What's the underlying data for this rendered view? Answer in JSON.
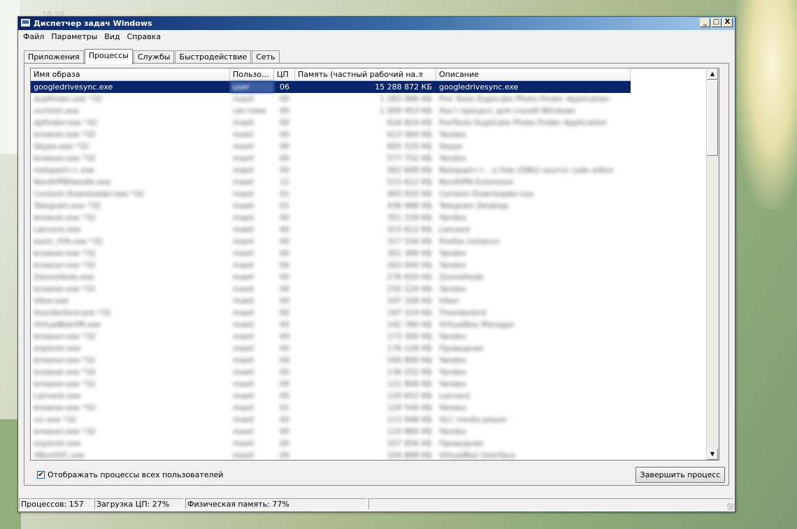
{
  "window": {
    "title": "Диспетчер задач Windows",
    "min": "_",
    "max": "□",
    "close": "X"
  },
  "menu": [
    "Файл",
    "Параметры",
    "Вид",
    "Справка"
  ],
  "tabs": [
    {
      "label": "Приложения",
      "active": false
    },
    {
      "label": "Процессы",
      "active": true
    },
    {
      "label": "Службы",
      "active": false
    },
    {
      "label": "Быстродействие",
      "active": false
    },
    {
      "label": "Сеть",
      "active": false
    }
  ],
  "columns": {
    "name": "Имя образа",
    "user": "Пользо...",
    "cpu": "ЦП",
    "memory": "Память (частный рабочий на...",
    "description": "Описание"
  },
  "processes": [
    {
      "name": "googledrivesync.exe",
      "user": "user",
      "cpu": "06",
      "memory": "15 288 872 КБ",
      "description": "googledrivesync.exe",
      "selected": true
    },
    {
      "name": "dupfinder.exe *32",
      "user": "maeli",
      "cpu": "00",
      "memory": "1 283 996 КБ",
      "description": "Fire Tools Duplicate Photo Finder Application"
    },
    {
      "name": "svchost.exe",
      "user": "система",
      "cpu": "00",
      "memory": "1 000 453 КБ",
      "description": "Хост-процесс для служб Windows"
    },
    {
      "name": "dpfinder.exe *32",
      "user": "maeli",
      "cpu": "00",
      "memory": "616 824 КБ",
      "description": "FireTools Duplicate Photo Finder Application"
    },
    {
      "name": "browser.exe *32",
      "user": "maeli",
      "cpu": "00",
      "memory": "613 564 КБ",
      "description": "Yandex"
    },
    {
      "name": "Skype.exe *32",
      "user": "maeli",
      "cpu": "00",
      "memory": "605 520 КБ",
      "description": "Skype"
    },
    {
      "name": "browser.exe *32",
      "user": "maeli",
      "cpu": "00",
      "memory": "577 752 КБ",
      "description": "Yandex"
    },
    {
      "name": "notepad++.exe",
      "user": "maeli",
      "cpu": "00",
      "memory": "562 608 КБ",
      "description": "Notepad++ : a free (GNU) source code editor"
    },
    {
      "name": "NordVPNHandle.exe",
      "user": "maeli",
      "cpu": "12",
      "memory": "515 612 КБ",
      "description": "NordVPN Extension"
    },
    {
      "name": "Content Downloader.exe *32",
      "user": "maeli",
      "cpu": "01",
      "memory": "493 920 КБ",
      "description": "Content Downloader.exe"
    },
    {
      "name": "Telegram.exe *32",
      "user": "maeli",
      "cpu": "01",
      "memory": "436 488 КБ",
      "description": "Telegram Desktop"
    },
    {
      "name": "browser.exe *32",
      "user": "maeli",
      "cpu": "00",
      "memory": "351 228 КБ",
      "description": "Yandex"
    },
    {
      "name": "Lanvent.exe",
      "user": "maeli",
      "cpu": "00",
      "memory": "315 612 КБ",
      "description": "Lanvent"
    },
    {
      "name": "basic_FFA.exe *32",
      "user": "maeli",
      "cpu": "00",
      "memory": "317 556 КБ",
      "description": "Firefox instance"
    },
    {
      "name": "browser.exe *32",
      "user": "maeli",
      "cpu": "00",
      "memory": "301 300 КБ",
      "description": "Yandex"
    },
    {
      "name": "browser.exe *32",
      "user": "maeli",
      "cpu": "00",
      "memory": "263 004 КБ",
      "description": "Yandex"
    },
    {
      "name": "ZennoHodo.exe",
      "user": "maeli",
      "cpu": "00",
      "memory": "276 620 КБ",
      "description": "ZennoHodo"
    },
    {
      "name": "browser.exe *32",
      "user": "maeli",
      "cpu": "00",
      "memory": "235 224 КБ",
      "description": "Yandex"
    },
    {
      "name": "Viber.exe",
      "user": "maeli",
      "cpu": "00",
      "memory": "197 328 КБ",
      "description": "Viber"
    },
    {
      "name": "thunderbird.exe *32",
      "user": "maeli",
      "cpu": "00",
      "memory": "197 224 КБ",
      "description": "Thunderbird"
    },
    {
      "name": "VirtualBoxVM.exe",
      "user": "maeli",
      "cpu": "00",
      "memory": "192 760 КБ",
      "description": "VirtualBox Manager"
    },
    {
      "name": "browser.exe *32",
      "user": "maeli",
      "cpu": "00",
      "memory": "173 300 КБ",
      "description": "Yandex"
    },
    {
      "name": "explorer.exe",
      "user": "maeli",
      "cpu": "00",
      "memory": "176 128 КБ",
      "description": "Проводник"
    },
    {
      "name": "browser.exe *32",
      "user": "maeli",
      "cpu": "00",
      "memory": "160 800 КБ",
      "description": "Yandex"
    },
    {
      "name": "browser.exe *32",
      "user": "maeli",
      "cpu": "00",
      "memory": "136 252 КБ",
      "description": "Yandex"
    },
    {
      "name": "browser.exe *32",
      "user": "maeli",
      "cpu": "00",
      "memory": "121 808 КБ",
      "description": "Yandex"
    },
    {
      "name": "Lanvent.exe",
      "user": "maeli",
      "cpu": "00",
      "memory": "120 652 КБ",
      "description": "Lanvent"
    },
    {
      "name": "browser.exe *32",
      "user": "maeli",
      "cpu": "01",
      "memory": "120 544 КБ",
      "description": "Yandex"
    },
    {
      "name": "vic.exe *32",
      "user": "maeli",
      "cpu": "00",
      "memory": "113 948 КБ",
      "description": "VLC media player"
    },
    {
      "name": "browser.exe *32",
      "user": "maeli",
      "cpu": "00",
      "memory": "110 884 КБ",
      "description": "Yandex"
    },
    {
      "name": "explorer.exe",
      "user": "maeli",
      "cpu": "00",
      "memory": "107 956 КБ",
      "description": "Проводник"
    },
    {
      "name": "VBoxSVC.exe",
      "user": "maeli",
      "cpu": "00",
      "memory": "104 868 КБ",
      "description": "VirtualBox Interface"
    }
  ],
  "show_all_users": {
    "label": "Отображать процессы всех пользователей",
    "checked": true
  },
  "end_process": "Завершить процесс",
  "status": {
    "processes": "Процессов: 157",
    "cpu": "Загрузка ЦП: 27%",
    "memory": "Физическая память: 77%"
  },
  "desktop_clock": "18:20"
}
